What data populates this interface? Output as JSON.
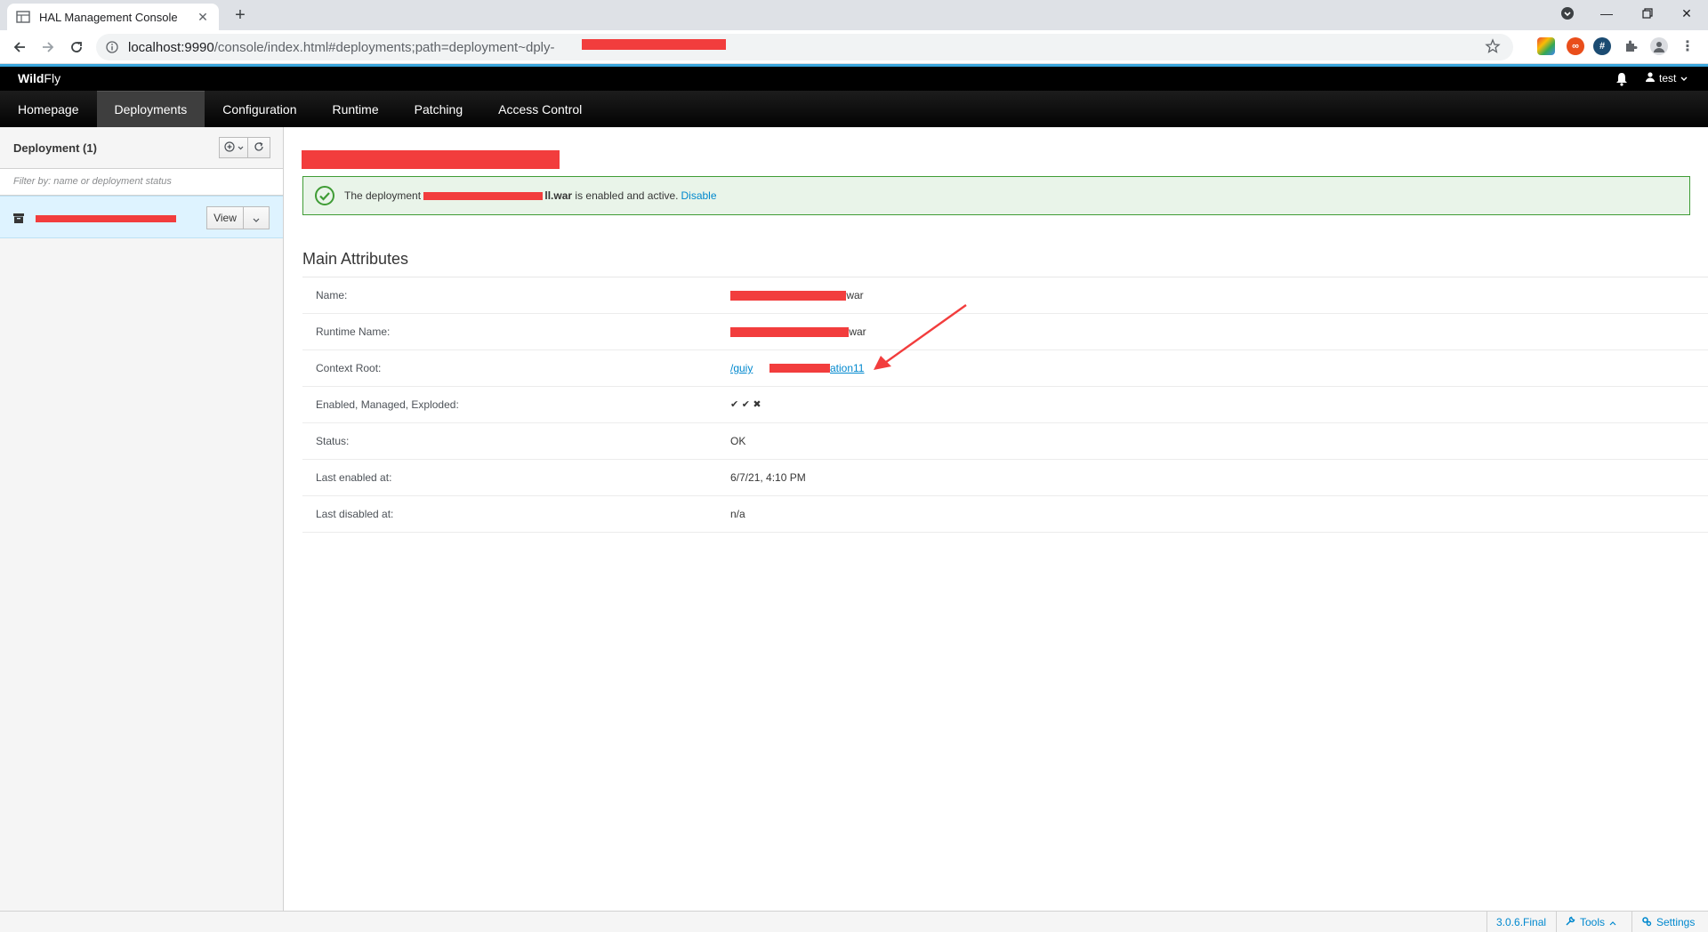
{
  "browser": {
    "tab_title": "HAL Management Console",
    "url_host": "localhost:9990",
    "url_path": "/console/index.html#deployments;path=deployment~dply-"
  },
  "app": {
    "brand_bold": "Wild",
    "brand_rest": "Fly",
    "user": "test",
    "nav": [
      "Homepage",
      "Deployments",
      "Configuration",
      "Runtime",
      "Patching",
      "Access Control"
    ],
    "active_nav": "Deployments"
  },
  "sidebar": {
    "title": "Deployment (1)",
    "filter_placeholder": "Filter by: name or deployment status",
    "view_label": "View"
  },
  "alert": {
    "prefix": "The deployment ",
    "war_fragment": "ll.war",
    "suffix": " is enabled and active.",
    "action": "Disable"
  },
  "main_attributes": {
    "title": "Main Attributes",
    "rows": [
      {
        "label": "Name:",
        "value": ".war"
      },
      {
        "label": "Runtime Name:",
        "value": ".war"
      },
      {
        "label": "Context Root:",
        "value_start": "/guiy",
        "value_end": "ation11"
      },
      {
        "label": "Enabled, Managed, Exploded:",
        "value": "✔ ✔ ✖"
      },
      {
        "label": "Status:",
        "value": "OK"
      },
      {
        "label": "Last enabled at:",
        "value": "6/7/21, 4:10 PM"
      },
      {
        "label": "Last disabled at:",
        "value": "n/a"
      }
    ]
  },
  "footer": {
    "version": "3.0.6.Final",
    "tools": "Tools",
    "settings": "Settings"
  },
  "colors": {
    "accent": "#0088ce",
    "success": "#3f9c35",
    "redaction": "#f23d3d"
  }
}
